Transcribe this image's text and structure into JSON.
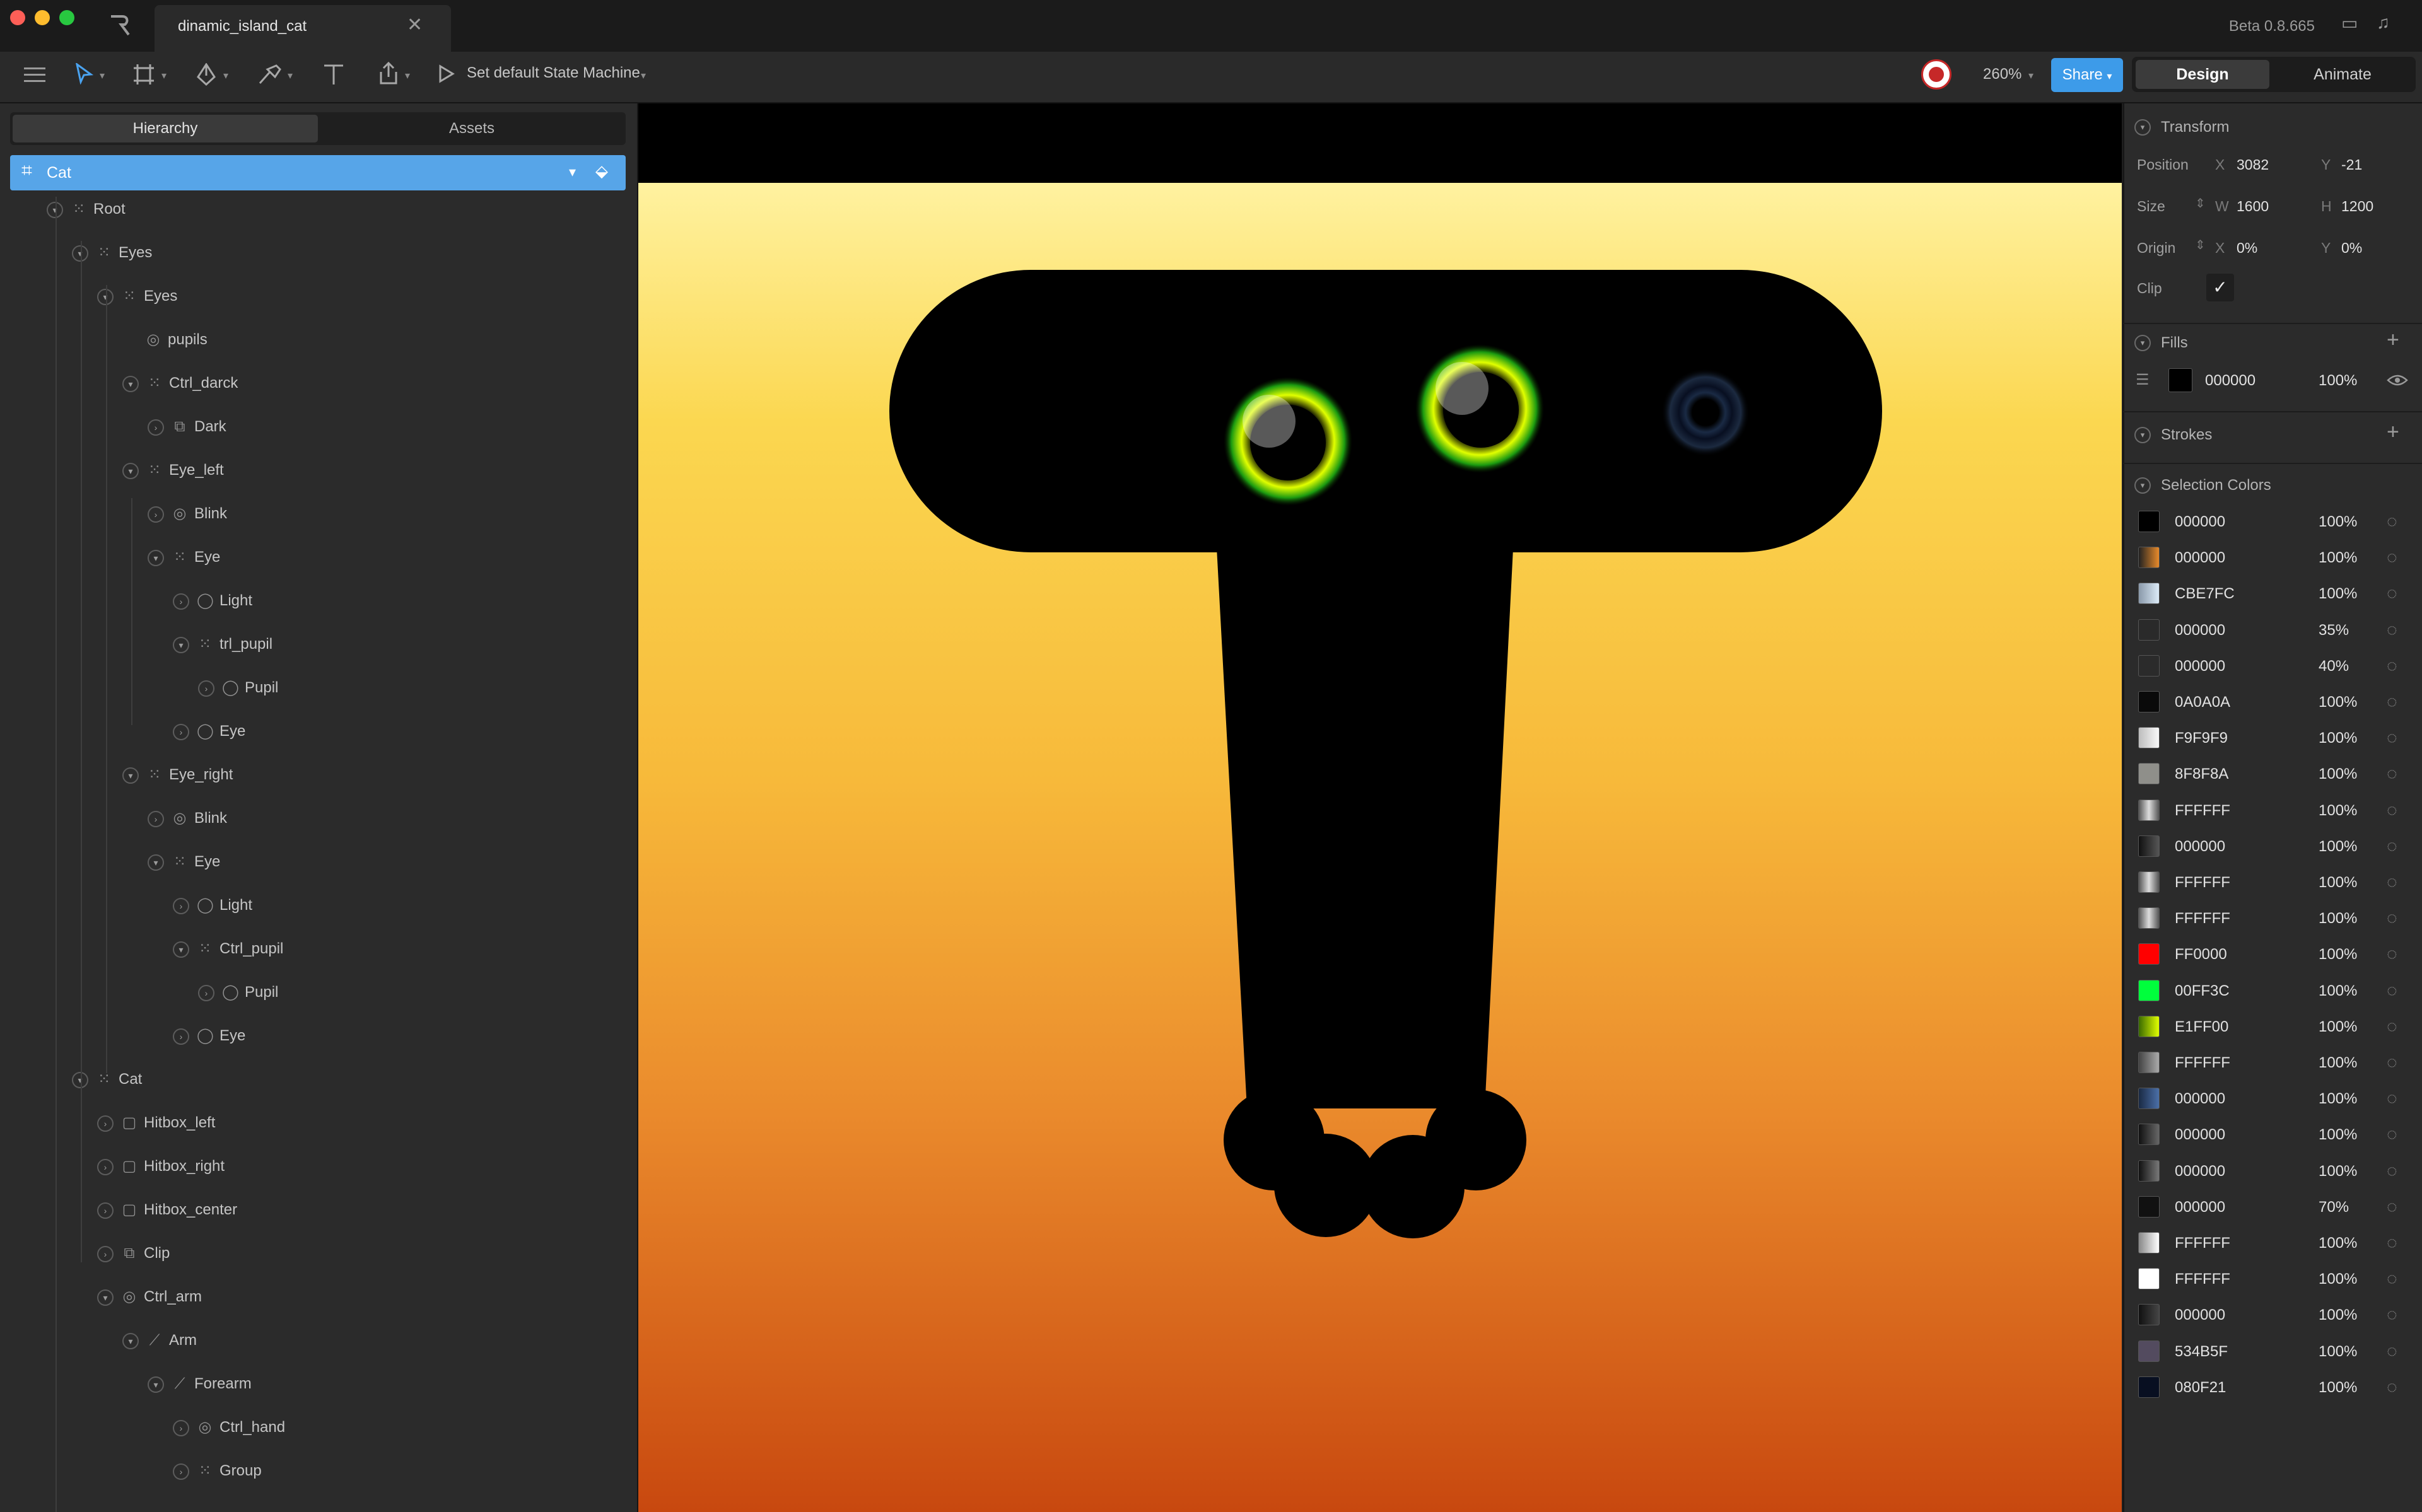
{
  "window": {
    "tab_title": "dinamic_island_cat",
    "close_glyph": "✕",
    "version": "Beta 0.8.665"
  },
  "toolbar": {
    "state_machine_label": "Set default State Machine",
    "zoom": "260%",
    "share_label": "Share",
    "modes": [
      "Design",
      "Animate"
    ],
    "active_mode": "Design"
  },
  "left_panel": {
    "tabs": [
      "Hierarchy",
      "Assets"
    ],
    "active_tab": "Hierarchy",
    "artboard": "Cat",
    "tree": [
      {
        "label": "Root",
        "depth": 0,
        "icon": "group-icon",
        "expanded": true
      },
      {
        "label": "Eyes",
        "depth": 1,
        "icon": "group-icon",
        "expanded": true
      },
      {
        "label": "Eyes",
        "depth": 2,
        "icon": "group-icon",
        "expanded": true
      },
      {
        "label": "pupils",
        "depth": 3,
        "icon": "target-icon",
        "expanded": null
      },
      {
        "label": "Ctrl_darck",
        "depth": 3,
        "icon": "group-icon",
        "expanded": true
      },
      {
        "label": "Dark",
        "depth": 4,
        "icon": "shapes-icon",
        "expanded": false
      },
      {
        "label": "Eye_left",
        "depth": 3,
        "icon": "group-icon",
        "expanded": true
      },
      {
        "label": "Blink",
        "depth": 4,
        "icon": "target-icon",
        "expanded": false
      },
      {
        "label": "Eye",
        "depth": 4,
        "icon": "group-icon",
        "expanded": true
      },
      {
        "label": "Light",
        "depth": 5,
        "icon": "ellipse-icon",
        "expanded": false
      },
      {
        "label": "trl_pupil",
        "depth": 5,
        "icon": "group-icon",
        "expanded": true
      },
      {
        "label": "Pupil",
        "depth": 6,
        "icon": "ellipse-icon",
        "expanded": false
      },
      {
        "label": "Eye",
        "depth": 5,
        "icon": "ellipse-icon",
        "expanded": false
      },
      {
        "label": "Eye_right",
        "depth": 3,
        "icon": "group-icon",
        "expanded": true
      },
      {
        "label": "Blink",
        "depth": 4,
        "icon": "target-icon",
        "expanded": false
      },
      {
        "label": "Eye",
        "depth": 4,
        "icon": "group-icon",
        "expanded": true
      },
      {
        "label": "Light",
        "depth": 5,
        "icon": "ellipse-icon",
        "expanded": false
      },
      {
        "label": "Ctrl_pupil",
        "depth": 5,
        "icon": "group-icon",
        "expanded": true
      },
      {
        "label": "Pupil",
        "depth": 6,
        "icon": "ellipse-icon",
        "expanded": false
      },
      {
        "label": "Eye",
        "depth": 5,
        "icon": "ellipse-icon",
        "expanded": false
      },
      {
        "label": "Cat",
        "depth": 1,
        "icon": "group-icon",
        "expanded": true
      },
      {
        "label": "Hitbox_left",
        "depth": 2,
        "icon": "rectangle-icon",
        "expanded": false
      },
      {
        "label": "Hitbox_right",
        "depth": 2,
        "icon": "rectangle-icon",
        "expanded": false
      },
      {
        "label": "Hitbox_center",
        "depth": 2,
        "icon": "rectangle-icon",
        "expanded": false
      },
      {
        "label": "Clip",
        "depth": 2,
        "icon": "shapes-icon",
        "expanded": false
      },
      {
        "label": "Ctrl_arm",
        "depth": 2,
        "icon": "target-icon",
        "expanded": true
      },
      {
        "label": "Arm",
        "depth": 3,
        "icon": "bone-icon",
        "expanded": true
      },
      {
        "label": "Forearm",
        "depth": 4,
        "icon": "bone-icon",
        "expanded": true
      },
      {
        "label": "Ctrl_hand",
        "depth": 5,
        "icon": "target-icon",
        "expanded": false
      },
      {
        "label": "Group",
        "depth": 5,
        "icon": "group-icon",
        "expanded": false
      }
    ]
  },
  "inspector": {
    "transform": {
      "title": "Transform",
      "position_label": "Position",
      "size_label": "Size",
      "origin_label": "Origin",
      "clip_label": "Clip",
      "x_axis": "X",
      "y_axis": "Y",
      "w_axis": "W",
      "h_axis": "H",
      "pos_x": "3082",
      "pos_y": "-21",
      "width": "1600",
      "height": "1200",
      "origin_x": "0%",
      "origin_y": "0%",
      "clip_checked": true
    },
    "fills": {
      "title": "Fills",
      "hex": "000000",
      "opacity": "100%",
      "swatch": "#000000"
    },
    "strokes": {
      "title": "Strokes"
    },
    "selection_colors": {
      "title": "Selection Colors",
      "items": [
        {
          "hex": "000000",
          "opacity": "100%",
          "swatch": "#000000"
        },
        {
          "hex": "000000",
          "opacity": "100%",
          "swatch": "linear-gradient(90deg,#222,#e88a2a)"
        },
        {
          "hex": "CBE7FC",
          "opacity": "100%",
          "swatch": "linear-gradient(90deg,#8a99aa,#dcebf7)"
        },
        {
          "hex": "000000",
          "opacity": "35%",
          "swatch": "#2a2a2a"
        },
        {
          "hex": "000000",
          "opacity": "40%",
          "swatch": "#2b2b2b"
        },
        {
          "hex": "0A0A0A",
          "opacity": "100%",
          "swatch": "#0a0a0a"
        },
        {
          "hex": "F9F9F9",
          "opacity": "100%",
          "swatch": "linear-gradient(90deg,#bdbdbd,#f9f9f9)"
        },
        {
          "hex": "8F8F8A",
          "opacity": "100%",
          "swatch": "#8f8f8a"
        },
        {
          "hex": "FFFFFF",
          "opacity": "100%",
          "swatch": "linear-gradient(90deg,#555,#ddd,#555)"
        },
        {
          "hex": "000000",
          "opacity": "100%",
          "swatch": "linear-gradient(90deg,#111,#555)"
        },
        {
          "hex": "FFFFFF",
          "opacity": "100%",
          "swatch": "linear-gradient(90deg,#555,#ddd,#555)"
        },
        {
          "hex": "FFFFFF",
          "opacity": "100%",
          "swatch": "linear-gradient(90deg,#555,#ddd,#555)"
        },
        {
          "hex": "FF0000",
          "opacity": "100%",
          "swatch": "#ff0000"
        },
        {
          "hex": "00FF3C",
          "opacity": "100%",
          "swatch": "#00ff3c"
        },
        {
          "hex": "E1FF00",
          "opacity": "100%",
          "swatch": "linear-gradient(90deg,#3a6a00,#e1ff00)"
        },
        {
          "hex": "FFFFFF",
          "opacity": "100%",
          "swatch": "linear-gradient(90deg,#444,#aaa)"
        },
        {
          "hex": "000000",
          "opacity": "100%",
          "swatch": "linear-gradient(90deg,#1a2a44,#4b6fa8)"
        },
        {
          "hex": "000000",
          "opacity": "100%",
          "swatch": "linear-gradient(90deg,#111,#666)"
        },
        {
          "hex": "000000",
          "opacity": "100%",
          "swatch": "linear-gradient(90deg,#111,#777)"
        },
        {
          "hex": "000000",
          "opacity": "70%",
          "swatch": "#111111"
        },
        {
          "hex": "FFFFFF",
          "opacity": "100%",
          "swatch": "linear-gradient(90deg,#888,#fff)"
        },
        {
          "hex": "FFFFFF",
          "opacity": "100%",
          "swatch": "#ffffff"
        },
        {
          "hex": "000000",
          "opacity": "100%",
          "swatch": "linear-gradient(90deg,#111,#444)"
        },
        {
          "hex": "534B5F",
          "opacity": "100%",
          "swatch": "#534b5f"
        },
        {
          "hex": "080F21",
          "opacity": "100%",
          "swatch": "#080f21"
        }
      ]
    }
  },
  "colors": {
    "accent": "#3d9be9",
    "selection_row": "#57a5e8",
    "avatar_ring": "#c62828"
  }
}
